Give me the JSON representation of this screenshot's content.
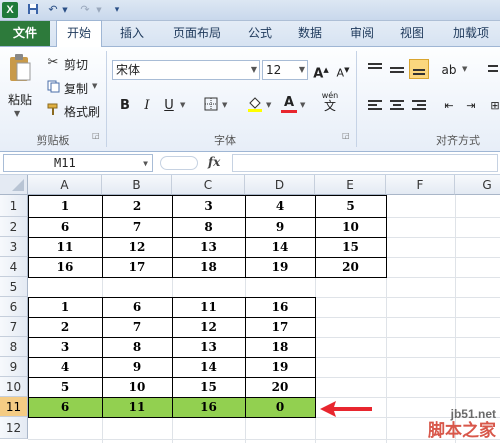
{
  "app": {
    "tabs": [
      "文件",
      "开始",
      "插入",
      "页面布局",
      "公式",
      "数据",
      "审阅",
      "视图",
      "加载项"
    ],
    "active_tab_index": 1
  },
  "ribbon": {
    "clipboard": {
      "paste_label": "粘贴",
      "cut_label": "剪切",
      "copy_label": "复制",
      "format_painter_label": "格式刷",
      "group_label": "剪贴板"
    },
    "font": {
      "font_name": "宋体",
      "font_size": "12",
      "bold": "B",
      "italic": "I",
      "underline": "U",
      "group_label": "字体",
      "phonetic": "wén"
    },
    "alignment": {
      "group_label": "对齐方式"
    }
  },
  "formula_bar": {
    "name_box": "M11",
    "fx_label": "fx",
    "formula": ""
  },
  "sheet": {
    "columns": [
      "A",
      "B",
      "C",
      "D",
      "E",
      "F",
      "G"
    ],
    "rows": [
      "1",
      "2",
      "3",
      "4",
      "5",
      "6",
      "7",
      "8",
      "9",
      "10",
      "11",
      "12"
    ],
    "selected_row": "11",
    "table1": [
      [
        "1",
        "2",
        "3",
        "4",
        "5"
      ],
      [
        "6",
        "7",
        "8",
        "9",
        "10"
      ],
      [
        "11",
        "12",
        "13",
        "14",
        "15"
      ],
      [
        "16",
        "17",
        "18",
        "19",
        "20"
      ]
    ],
    "table2": [
      [
        "1",
        "6",
        "11",
        "16"
      ],
      [
        "2",
        "7",
        "12",
        "17"
      ],
      [
        "3",
        "8",
        "13",
        "18"
      ],
      [
        "4",
        "9",
        "14",
        "19"
      ],
      [
        "5",
        "10",
        "15",
        "20"
      ]
    ],
    "highlight_row": [
      "6",
      "11",
      "16",
      "0"
    ],
    "highlight_color": "#92d050",
    "arrow_color": "#e8262e"
  },
  "watermark": {
    "site": "jb51.net",
    "name": "脚本之家"
  }
}
